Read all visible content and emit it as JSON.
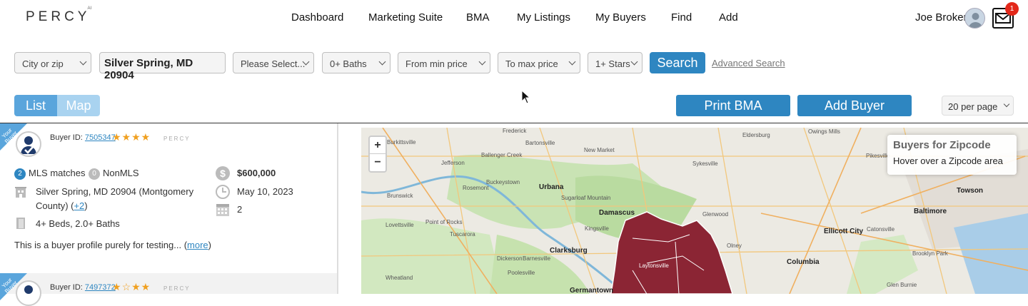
{
  "header": {
    "logo": "PERCY",
    "logo_sup": "AI",
    "nav": [
      "Dashboard",
      "Marketing Suite",
      "BMA",
      "My Listings",
      "My Buyers",
      "Find",
      "Add"
    ],
    "user_name": "Joe Broker",
    "notifications": "1"
  },
  "filters": {
    "city_zip": "City or zip",
    "location": "Silver Spring, MD 20904",
    "beds": "Please Select...",
    "baths": "0+ Baths",
    "min_price": "From min price",
    "max_price": "To max price",
    "stars": "1+ Stars",
    "search": "Search",
    "advanced": "Advanced Search"
  },
  "view": {
    "list": "List",
    "map": "Map",
    "print": "Print BMA",
    "add_buyer": "Add Buyer",
    "per_page": "20 per page"
  },
  "buyers": [
    {
      "ribbon": "Your Buyer",
      "id_label": "Buyer ID:",
      "id": "7505347",
      "stars": 4,
      "mls_count": "2",
      "mls_label": "MLS matches",
      "nonmls_count": "0",
      "nonmls_label": "NonMLS",
      "price": "$600,000",
      "location": "Silver Spring, MD 20904 (Montgomery",
      "location2": "County) (",
      "more_loc": "+2",
      "location_end": ")",
      "date": "May 10, 2023",
      "count": "2",
      "beds": "4+ Beds, 2.0+ Baths",
      "desc": "This is a buyer profile purely for testing... (",
      "more": "more",
      "desc_end": ")"
    },
    {
      "ribbon": "Your Buyer",
      "id_label": "Buyer ID:",
      "id": "7497372",
      "stars": 3
    }
  ],
  "map": {
    "zoom_in": "+",
    "zoom_out": "−",
    "legend_title": "Buyers for Zipcode",
    "legend_sub": "Hover over a Zipcode area",
    "labels": [
      {
        "t": "Frederick"
      },
      {
        "t": "Burkittsville"
      },
      {
        "t": "Bartonsville"
      },
      {
        "t": "Ballenger Creek"
      },
      {
        "t": "New Market"
      },
      {
        "t": "Jefferson"
      },
      {
        "t": "Buckeystown"
      },
      {
        "t": "Urbana"
      },
      {
        "t": "Brunswick"
      },
      {
        "t": "Rosemont"
      },
      {
        "t": "Sugarloaf Mountain"
      },
      {
        "t": "Damascus"
      },
      {
        "t": "Clarksburg"
      },
      {
        "t": "Barnesville"
      },
      {
        "t": "Dickerson"
      },
      {
        "t": "Poolesville"
      },
      {
        "t": "Germantown"
      },
      {
        "t": "Wheatland"
      },
      {
        "t": "Eldersburg"
      },
      {
        "t": "Sykesville"
      },
      {
        "t": "Glenwood"
      },
      {
        "t": "Ellicott City"
      },
      {
        "t": "Columbia"
      },
      {
        "t": "Catonsville"
      },
      {
        "t": "Owings Mills"
      },
      {
        "t": "Pikesville"
      },
      {
        "t": "Towson"
      },
      {
        "t": "Baltimore"
      },
      {
        "t": "Brooklyn Park"
      },
      {
        "t": "Glen Burnie"
      },
      {
        "t": "Lovettsville"
      },
      {
        "t": "Point of Rocks"
      },
      {
        "t": "Tuscarora"
      },
      {
        "t": "Kingsville"
      },
      {
        "t": "Laytonsville"
      },
      {
        "t": "Olney"
      }
    ]
  }
}
